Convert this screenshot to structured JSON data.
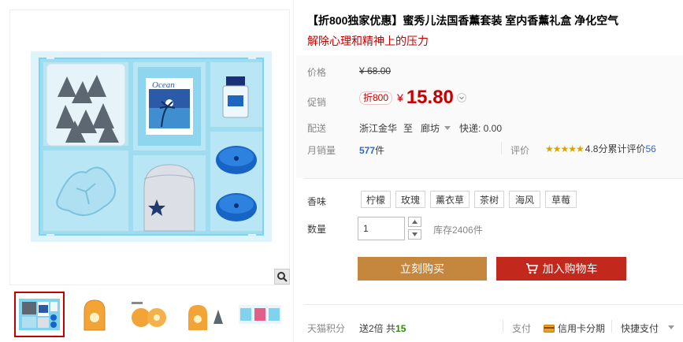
{
  "product": {
    "title": "【折800独家优惠】蜜秀儿法国香薰套装 室内香薰礼盒 净化空气",
    "subtitle": "解除心理和精神上的压力"
  },
  "gallery": {
    "main_image_label": "Ocean",
    "thumb_count": 5,
    "active_thumb": 0
  },
  "price": {
    "label": "价格",
    "original": "¥ 68.00"
  },
  "promo": {
    "label": "促销",
    "badge": "折800",
    "currency": "¥",
    "amount": "15.80"
  },
  "delivery": {
    "label": "配送",
    "from": "浙江金华",
    "to_word": "至",
    "to": "廊坊",
    "shipping": "快递: 0.00"
  },
  "sales": {
    "label": "月销量",
    "count": "577",
    "unit": "件",
    "review_label": "评价",
    "stars": "★★★★★",
    "rating": "4.8分",
    "review_count_label": "累计评价",
    "review_count": "56"
  },
  "scent": {
    "label": "香味",
    "options": [
      "柠檬",
      "玫瑰",
      "薰衣草",
      "茶树",
      "海风",
      "草莓"
    ]
  },
  "quantity": {
    "label": "数量",
    "value": "1",
    "stock": "库存2406件"
  },
  "actions": {
    "buy_now": "立刻购买",
    "add_to_cart": "加入购物车"
  },
  "footer": {
    "points_label": "天猫积分",
    "points_text": "送2倍 共",
    "points_value": "15",
    "pay_label": "支付",
    "credit": "信用卡分期",
    "quick_pay": "快捷支付"
  },
  "colors": {
    "accent_red": "#c40000",
    "buy_now": "#c5873d",
    "add_cart": "#c3281c",
    "points_green": "#2e8b00",
    "link_blue": "#3366cc"
  }
}
